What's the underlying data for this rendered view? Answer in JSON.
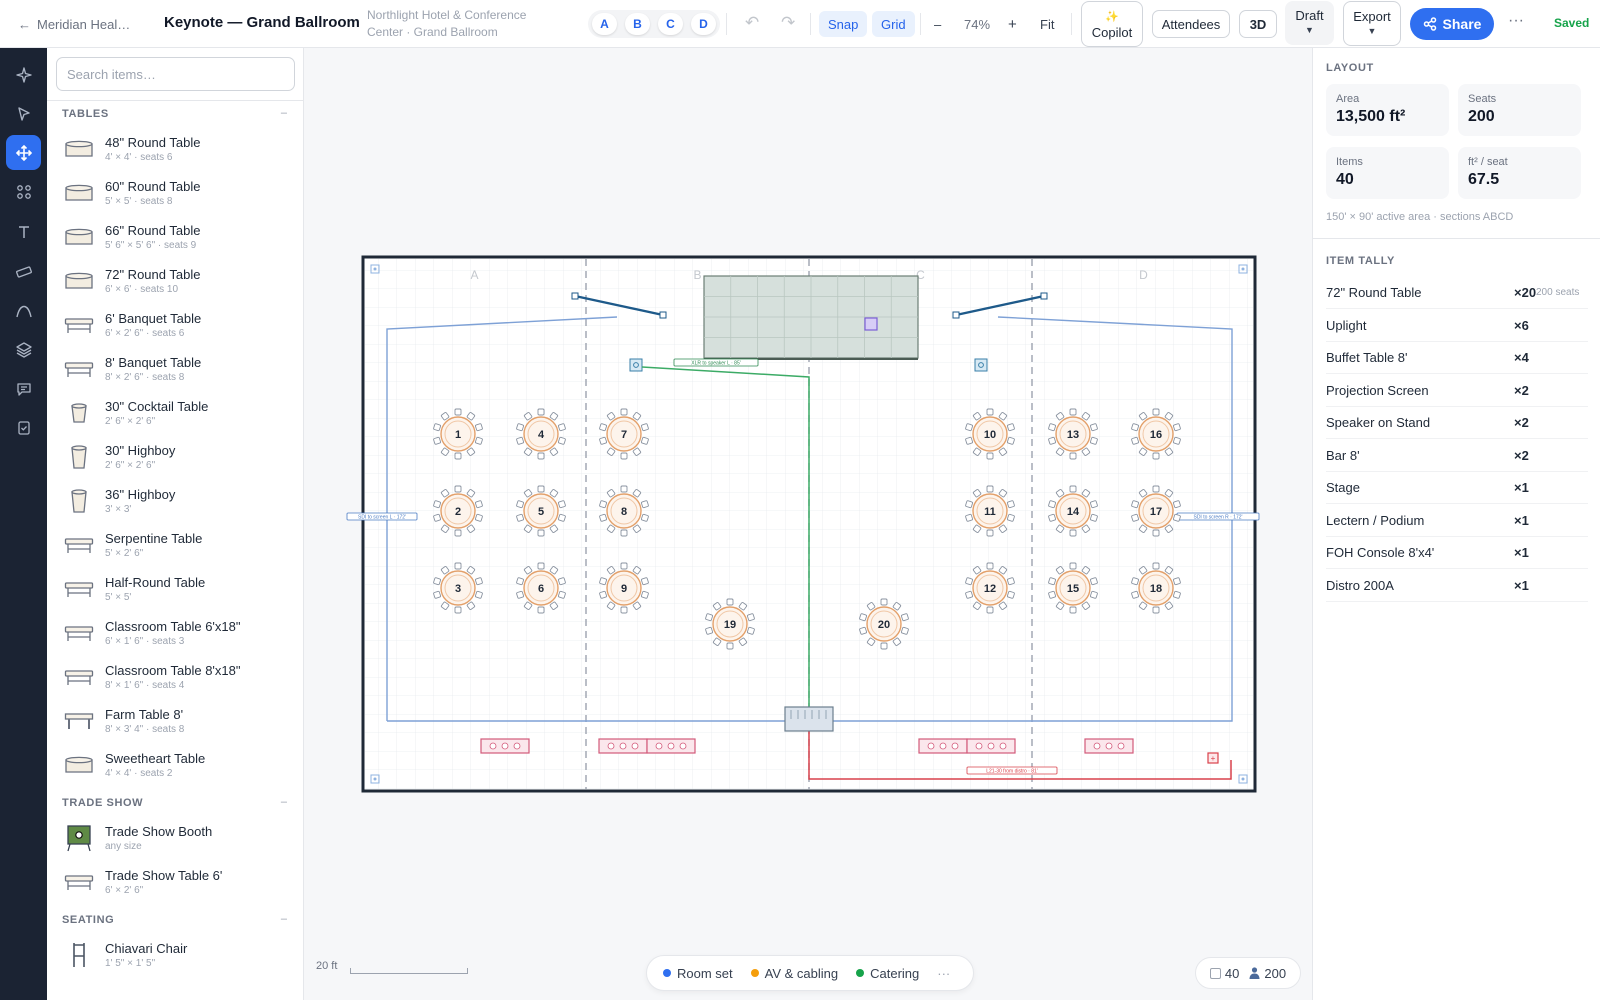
{
  "topbar": {
    "back_label": "Meridian Heal…",
    "title": "Keynote — Grand Ballroom",
    "venue_line1": "Northlight Hotel & Conference",
    "venue_line2": "Center · Grand Ballroom",
    "sections": [
      "A",
      "B",
      "C",
      "D"
    ],
    "snap_label": "Snap",
    "grid_label": "Grid",
    "zoom_minus": "–",
    "zoom_value": "74%",
    "zoom_plus": "+",
    "fit_label": "Fit",
    "copilot_label": "Copilot",
    "attendees_label": "Attendees",
    "three_d_label": "3D",
    "draft_label": "Draft",
    "export_label": "Export",
    "share_label": "Share",
    "more_label": "···",
    "saved_label": "Saved"
  },
  "rail": {
    "icons": [
      "sparkle-icon",
      "cursor-icon",
      "move-icon",
      "grid-dots-icon",
      "text-icon",
      "ruler-icon",
      "curve-icon",
      "layers-icon",
      "chat-icon",
      "checklist-icon"
    ],
    "active_index": 2
  },
  "library": {
    "search_placeholder": "Search items…",
    "groups": [
      {
        "title": "TABLES",
        "items": [
          {
            "name": "48\" Round Table",
            "meta": "4' × 4' · seats 6",
            "icon": "round"
          },
          {
            "name": "60\" Round Table",
            "meta": "5' × 5' · seats 8",
            "icon": "round"
          },
          {
            "name": "66\" Round Table",
            "meta": "5' 6\" × 5' 6\" · seats 9",
            "icon": "round"
          },
          {
            "name": "72\" Round Table",
            "meta": "6' × 6' · seats 10",
            "icon": "round"
          },
          {
            "name": "6' Banquet Table",
            "meta": "6' × 2' 6\" · seats 6",
            "icon": "rect"
          },
          {
            "name": "8' Banquet Table",
            "meta": "8' × 2' 6\" · seats 8",
            "icon": "rect"
          },
          {
            "name": "30\" Cocktail Table",
            "meta": "2' 6\" × 2' 6\"",
            "icon": "cocktail"
          },
          {
            "name": "30\" Highboy",
            "meta": "2' 6\" × 2' 6\"",
            "icon": "highboy"
          },
          {
            "name": "36\" Highboy",
            "meta": "3' × 3'",
            "icon": "highboy"
          },
          {
            "name": "Serpentine Table",
            "meta": "5' × 2' 6\"",
            "icon": "rect"
          },
          {
            "name": "Half-Round Table",
            "meta": "5' × 5'",
            "icon": "rect"
          },
          {
            "name": "Classroom Table 6'x18\"",
            "meta": "6' × 1' 6\" · seats 3",
            "icon": "rect"
          },
          {
            "name": "Classroom Table 8'x18\"",
            "meta": "8' × 1' 6\" · seats 4",
            "icon": "rect"
          },
          {
            "name": "Farm Table 8'",
            "meta": "8' × 3' 4\" · seats 8",
            "icon": "farm"
          },
          {
            "name": "Sweetheart Table",
            "meta": "4' × 4' · seats 2",
            "icon": "round"
          }
        ]
      },
      {
        "title": "TRADE SHOW",
        "items": [
          {
            "name": "Trade Show Booth",
            "meta": "any size",
            "icon": "booth"
          },
          {
            "name": "Trade Show Table 6'",
            "meta": "6' × 2' 6\"",
            "icon": "rect"
          }
        ]
      },
      {
        "title": "SEATING",
        "items": [
          {
            "name": "Chiavari Chair",
            "meta": "1' 5\" × 1' 5\"",
            "icon": "chair"
          }
        ]
      }
    ]
  },
  "canvas": {
    "section_labels": [
      "A",
      "B",
      "C",
      "D"
    ],
    "table_numbers": [
      "1",
      "2",
      "3",
      "4",
      "5",
      "6",
      "7",
      "8",
      "9",
      "10",
      "11",
      "12",
      "13",
      "14",
      "15",
      "16",
      "17",
      "18",
      "19",
      "20"
    ],
    "cable_labels": {
      "xlr": "XLR to speaker L · 85'",
      "sdi_left": "SDI to screen L · 172'",
      "sdi_right": "SDI to screen R · 172'",
      "power": "L21-30 from distro · 81'"
    },
    "scale_label": "20 ft",
    "layers": [
      {
        "label": "Room set",
        "color": "#2f6ff0"
      },
      {
        "label": "AV & cabling",
        "color": "#f59e0b"
      },
      {
        "label": "Catering",
        "color": "#16a34a"
      }
    ],
    "layers_more": "···",
    "item_count": "40",
    "people_count": "200"
  },
  "panel": {
    "layout_title": "LAYOUT",
    "stats": [
      {
        "label": "Area",
        "value": "13,500 ft²"
      },
      {
        "label": "Seats",
        "value": "200"
      },
      {
        "label": "Items",
        "value": "40"
      },
      {
        "label": "ft² / seat",
        "value": "67.5"
      }
    ],
    "note": "150' × 90' active area · sections ABCD",
    "tally_title": "ITEM TALLY",
    "tally": [
      {
        "name": "72\" Round Table",
        "count": "×20",
        "seats": "200 seats"
      },
      {
        "name": "Uplight",
        "count": "×6",
        "seats": ""
      },
      {
        "name": "Buffet Table 8'",
        "count": "×4",
        "seats": ""
      },
      {
        "name": "Projection Screen",
        "count": "×2",
        "seats": ""
      },
      {
        "name": "Speaker on Stand",
        "count": "×2",
        "seats": ""
      },
      {
        "name": "Bar 8'",
        "count": "×2",
        "seats": ""
      },
      {
        "name": "Stage",
        "count": "×1",
        "seats": ""
      },
      {
        "name": "Lectern / Podium",
        "count": "×1",
        "seats": ""
      },
      {
        "name": "FOH Console 8'x4'",
        "count": "×1",
        "seats": ""
      },
      {
        "name": "Distro 200A",
        "count": "×1",
        "seats": ""
      }
    ]
  }
}
